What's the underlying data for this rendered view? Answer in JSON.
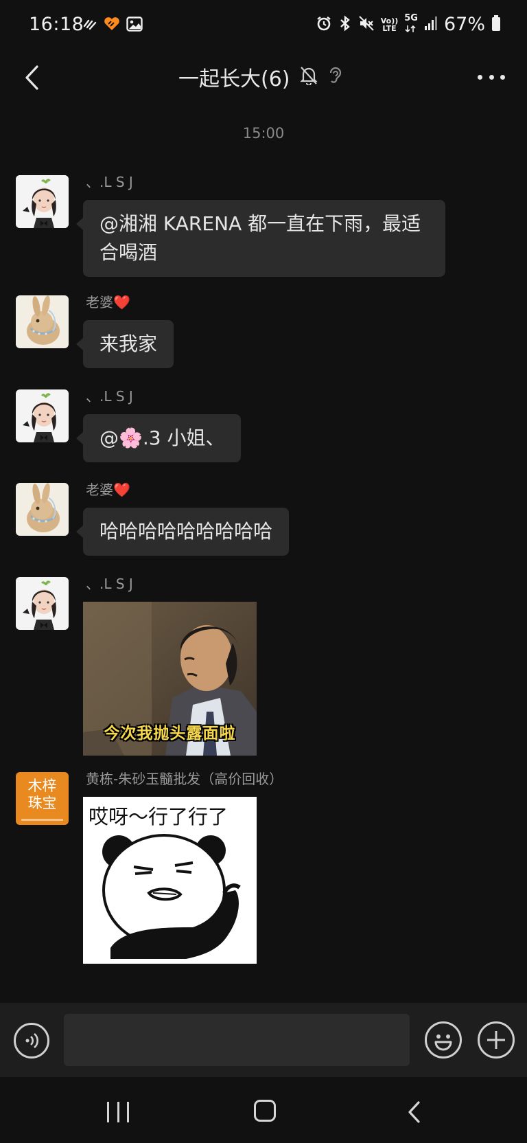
{
  "status_bar": {
    "time": "16:18",
    "battery": "67%",
    "network_top": "5G",
    "volte_top": "Vo))",
    "volte_bottom": "LTE",
    "icons": [
      "notification-icon",
      "heart-app-icon",
      "image-icon",
      "alarm-icon",
      "bluetooth-icon",
      "mute-icon",
      "volte-icon",
      "5g-icon",
      "signal-icon",
      "battery-icon"
    ]
  },
  "header": {
    "title": "一起长大(6)",
    "icons": [
      "back-icon",
      "mute-bell-icon",
      "ear-icon",
      "more-icon"
    ]
  },
  "timestamp": "15:00",
  "messages": [
    {
      "sender": "、.L S J",
      "text": "@湘湘 KARENA  都一直在下雨，最适合喝酒"
    },
    {
      "sender": "老婆❤️",
      "text": "来我家"
    },
    {
      "sender": "、.L S J",
      "text": "@🌸.3 小姐、"
    },
    {
      "sender": "老婆❤️",
      "text": "哈哈哈哈哈哈哈哈哈"
    },
    {
      "sender": "、.L S J",
      "image_caption": "今次我抛头露面啦"
    },
    {
      "sender": "黄栋-朱砂玉髓批发（高价回收）",
      "image_caption": "哎呀～行了行了",
      "avatar_text_1": "木梓",
      "avatar_text_2": "珠宝"
    }
  ],
  "input_bar": {
    "input_value": "",
    "icons": [
      "voice-icon",
      "emoji-icon",
      "plus-icon"
    ]
  },
  "nav_bar": {
    "icons": [
      "recents-icon",
      "home-icon",
      "nav-back-icon"
    ]
  },
  "colors": {
    "background": "#111111",
    "bubble": "#2c2c2c",
    "input_bar": "#1e1e1e",
    "text": "#e6e6e6",
    "muted": "#9a9a9a",
    "avatar_orange": "#e88a1f"
  }
}
